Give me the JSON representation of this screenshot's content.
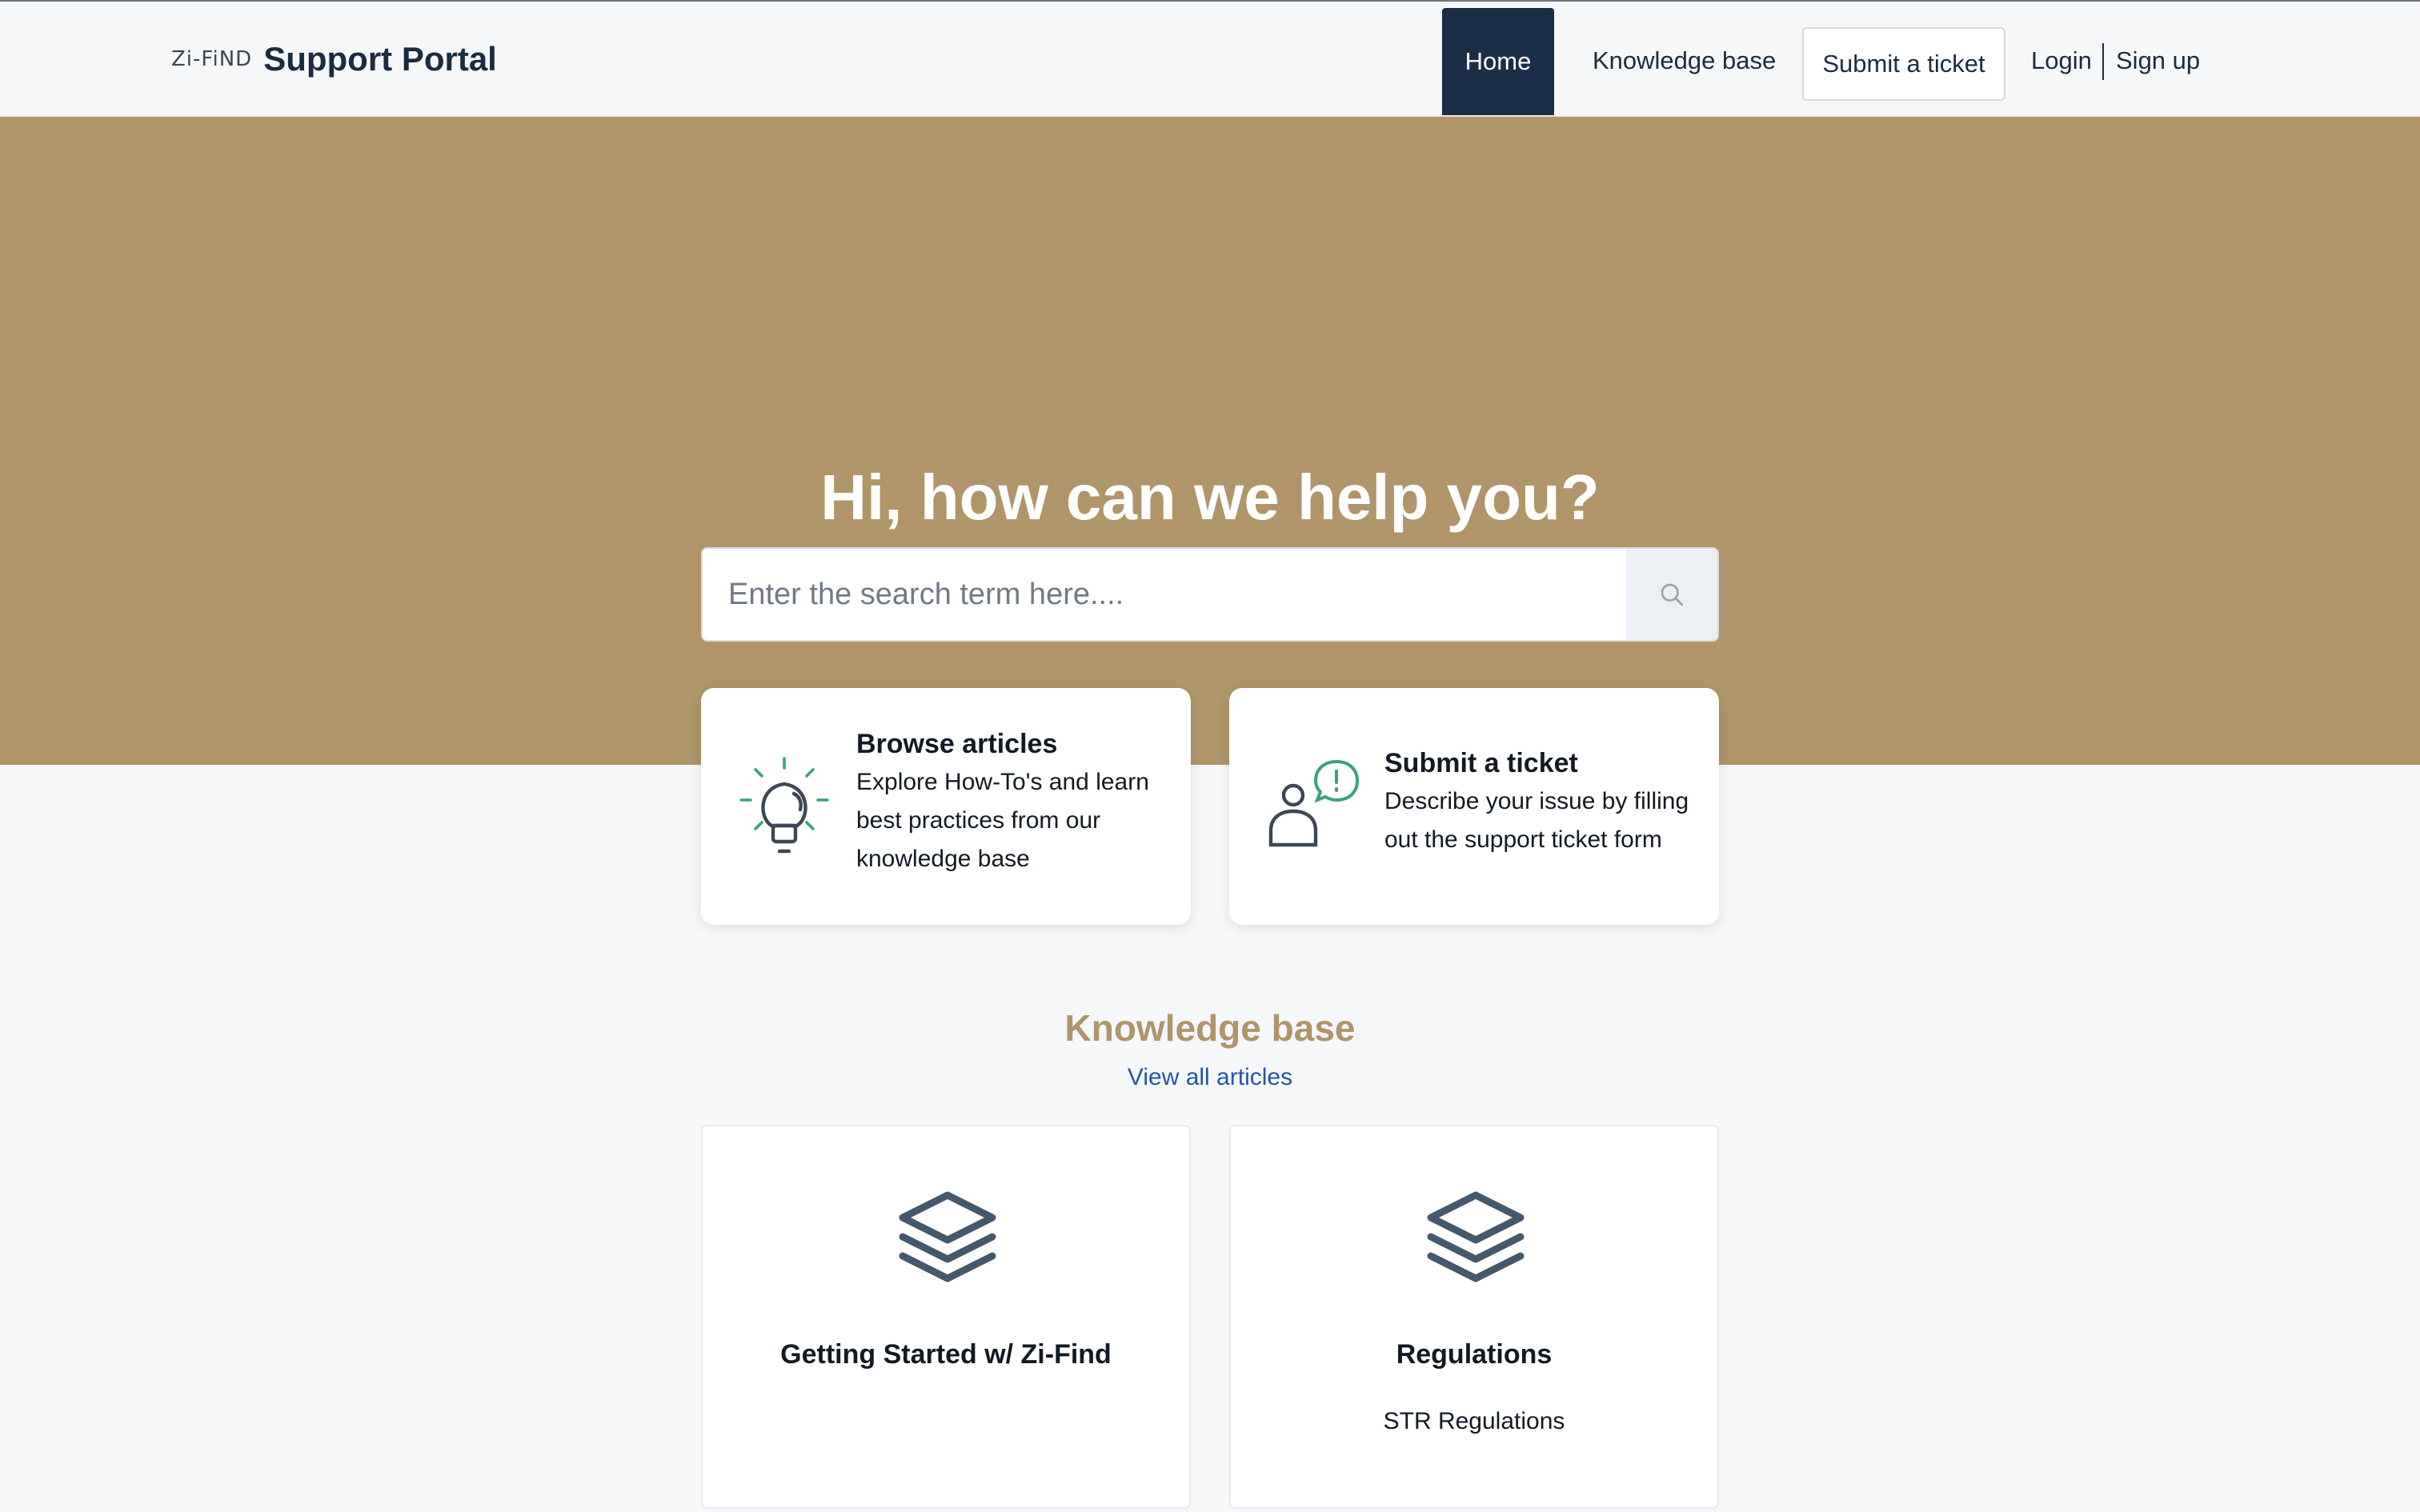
{
  "header": {
    "logo_text": "Zi-FiND",
    "title": "Support Portal",
    "nav": {
      "home": "Home",
      "knowledge_base": "Knowledge base",
      "submit_ticket": "Submit a ticket",
      "login": "Login",
      "signup": "Sign up"
    }
  },
  "hero": {
    "title": "Hi, how can we help you?",
    "search_placeholder": "Enter the search term here....",
    "search_icon": "search-icon"
  },
  "cards": [
    {
      "icon": "lightbulb-icon",
      "title": "Browse articles",
      "description": "Explore How-To's and learn best practices from our knowledge base"
    },
    {
      "icon": "user-alert-icon",
      "title": "Submit a ticket",
      "description": "Describe your issue by filling out the support ticket form"
    }
  ],
  "knowledge_base": {
    "heading": "Knowledge base",
    "view_all": "View all articles",
    "categories": [
      {
        "icon": "layers-icon",
        "title": "Getting Started w/ Zi-Find",
        "description": ""
      },
      {
        "icon": "layers-icon",
        "title": "Regulations",
        "description": "STR Regulations"
      }
    ]
  },
  "colors": {
    "hero_bg": "#b0956a",
    "nav_active_bg": "#1b2e47",
    "accent_icon": "#3aa17e",
    "link": "#2456a6",
    "page_bg": "#f5f7f9"
  }
}
